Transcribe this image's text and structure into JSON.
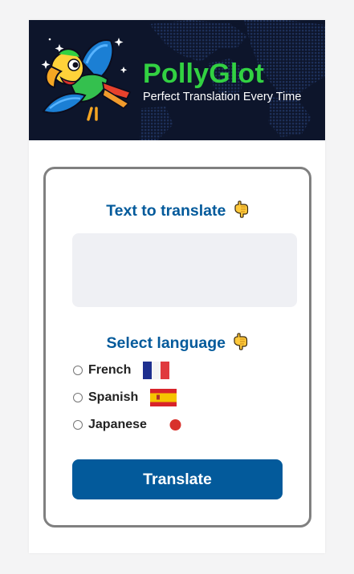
{
  "header": {
    "brand": "PollyGlot",
    "tagline": "Perfect Translation Every Time",
    "logo_icon": "parrot-icon"
  },
  "form": {
    "text_heading": "Text to translate",
    "text_value": "",
    "text_placeholder": "",
    "language_heading": "Select language",
    "pointer_icon": "pointing-down-hand-icon",
    "languages": [
      {
        "label": "French",
        "flag_icon": "france-flag-icon",
        "selected": false
      },
      {
        "label": "Spanish",
        "flag_icon": "spain-flag-icon",
        "selected": false
      },
      {
        "label": "Japanese",
        "flag_icon": "japan-flag-icon",
        "selected": false
      }
    ],
    "translate_label": "Translate"
  },
  "colors": {
    "header_bg": "#0d152b",
    "brand_green": "#32d142",
    "accent_blue": "#035a9b",
    "card_border": "#808080",
    "input_bg": "#eff0f4"
  }
}
